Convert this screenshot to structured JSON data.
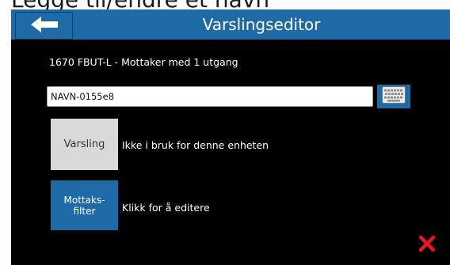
{
  "caption": "Legge til/endre et navn",
  "header": {
    "title": "Varslingseditor",
    "back_icon": "back-arrow-icon",
    "color": "#1e6aa6"
  },
  "device": {
    "description": "1670 FBUT-L - Mottaker med 1 utgang"
  },
  "name_field": {
    "value": "NAVN-0155e8"
  },
  "keyboard_button": {
    "icon": "keyboard-icon"
  },
  "varsling": {
    "button_label": "Varsling",
    "status": "Ikke i bruk for denne enheten",
    "color": "#d9d9d9"
  },
  "mottaksfilter": {
    "button_label": "Mottaks-\nfilter",
    "hint": "Klikk for å editere",
    "color": "#1e6aa6"
  },
  "close_button": {
    "icon": "close-icon",
    "color": "#e8181b"
  }
}
